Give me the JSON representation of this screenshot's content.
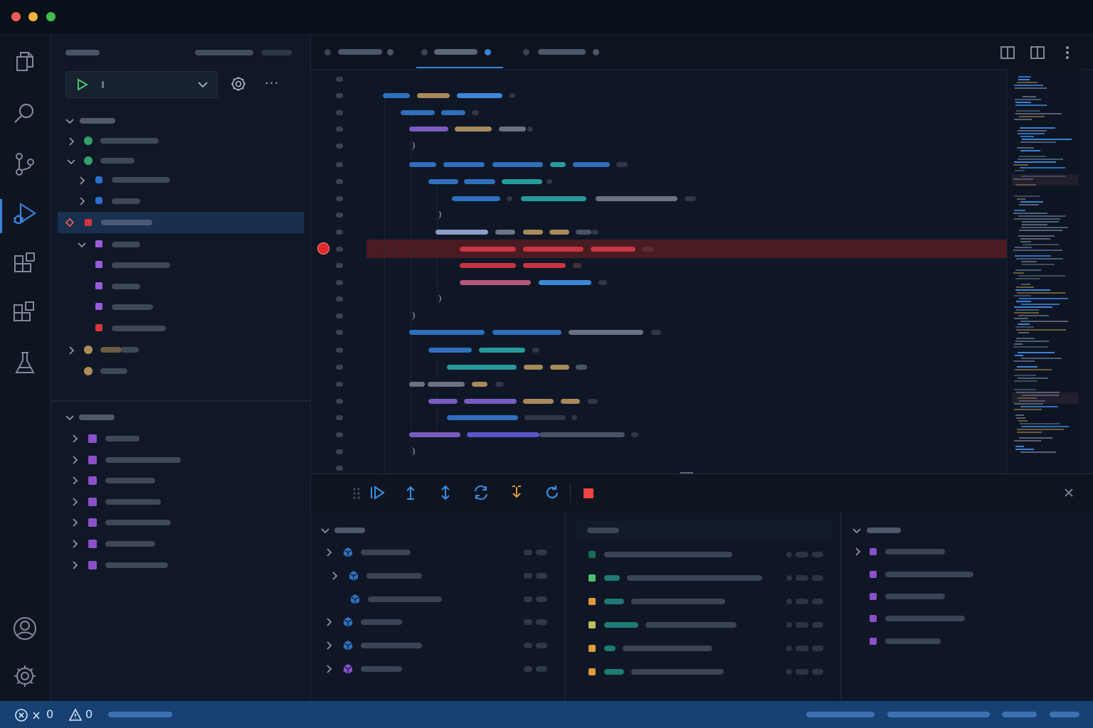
{
  "status": {
    "errors_count": "0",
    "warnings_count": "0"
  },
  "debug_toolbar": {
    "buttons": [
      "continue",
      "step-over",
      "step-into",
      "restart-frame",
      "step-out",
      "restart",
      "stop"
    ]
  },
  "colors": {
    "status_bar": "#174173",
    "accent": "#3b82d6",
    "breakpoint": "#e5262b",
    "breakpoint_line": "#4a1b22",
    "stop": "#ef4444"
  },
  "icons": {
    "activity_bar": [
      "files-icon",
      "search-icon",
      "source-control-icon",
      "run-debug-icon",
      "extensions-icon",
      "remote-icon",
      "testing-icon",
      "account-icon",
      "settings-icon"
    ]
  }
}
